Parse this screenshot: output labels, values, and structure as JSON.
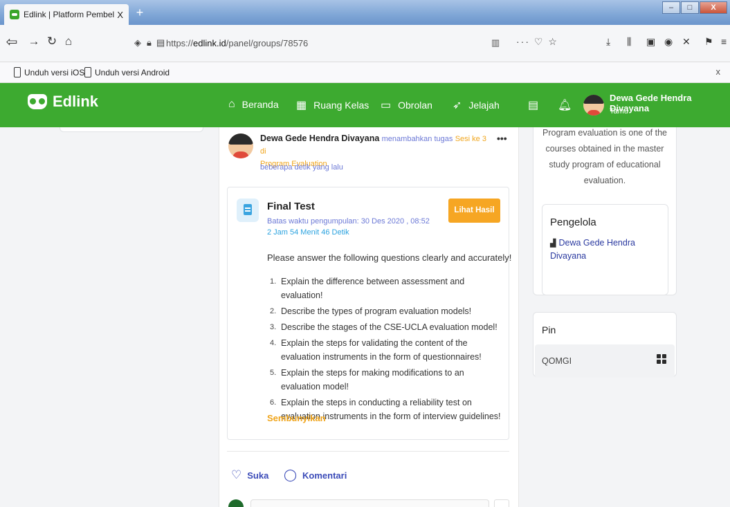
{
  "browser": {
    "tab_title": "Edlink | Platform Pembelajaran",
    "tab_close": "X",
    "new_tab": "+",
    "url_prefix": "https://",
    "url_domain": "edlink.id",
    "url_path": "/panel/groups/78576",
    "bookmarks": [
      "Unduh versi iOS",
      "Unduh versi Android"
    ],
    "bookmark_close": "x",
    "window_controls": [
      "–",
      "□",
      "X"
    ]
  },
  "app": {
    "brand": "Edlink",
    "menu": [
      "Beranda",
      "Ruang Kelas",
      "Obrolan",
      "Jelajah"
    ],
    "user_name": "Dewa Gede Hendra Divayana",
    "user_role": "Tamu",
    "accent_color": "#3daa30"
  },
  "post": {
    "author": "Dewa Gede Hendra Divayana",
    "verb": "menambahkan tugas",
    "session_link": "Sesi ke 3 di",
    "course_link": "Program Evaluation",
    "time": "beberapa detik yang lalu",
    "more": "•••"
  },
  "task": {
    "title": "Final Test",
    "deadline": "Batas waktu pengumpulan: 30 Des 2020 , 08:52",
    "remaining": "2 Jam 54 Menit 46 Detik",
    "button": "Lihat Hasil",
    "intro": "Please answer the following questions clearly and accurately!",
    "questions": [
      {
        "num": "1.",
        "text": "Explain the difference between assessment and evaluation!"
      },
      {
        "num": "2.",
        "text": "Describe the types of program evaluation models!"
      },
      {
        "num": "3.",
        "text": "Describe the stages of the CSE-UCLA evaluation model!"
      },
      {
        "num": "4.",
        "text": "Explain the steps for validating the content of the evaluation instruments in the form of questionnaires!"
      },
      {
        "num": "5.",
        "text": "Explain the steps for making modifications to an evaluation model!"
      },
      {
        "num": "6.",
        "text": "Explain the steps in conducting a reliability test on evaluation instruments in the form of interview guidelines!"
      }
    ],
    "hide": "Sembunyikan"
  },
  "reactions": {
    "like": "Suka",
    "comment": "Komentari"
  },
  "sidebar": {
    "description": "Program evaluation is one of the courses obtained in the master study program of educational evaluation.",
    "manager_title": "Pengelola",
    "manager_name": "Dewa Gede Hendra Divayana",
    "pin_title": "Pin",
    "pin_code": "QOMGI"
  }
}
